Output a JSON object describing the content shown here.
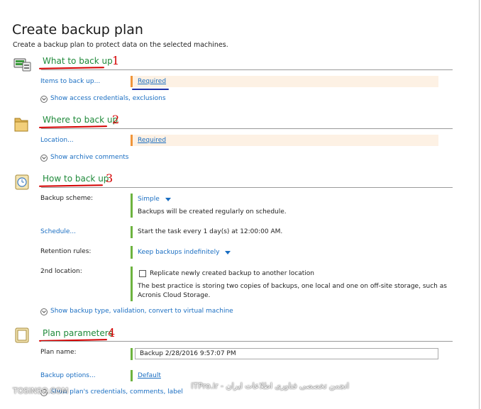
{
  "page": {
    "title": "Create backup plan",
    "subtitle": "Create a backup plan to protect data on the selected machines."
  },
  "sections": {
    "what": {
      "title": "What to back up",
      "number": "1",
      "items_label": "Items to back up...",
      "items_value": "Required",
      "expand_link": "Show access credentials, exclusions"
    },
    "where": {
      "title": "Where to back up",
      "number": "2",
      "location_label": "Location...",
      "location_value": "Required",
      "expand_link": "Show archive comments"
    },
    "how": {
      "title": "How to back up",
      "number": "3",
      "scheme_label": "Backup scheme:",
      "scheme_value": "Simple",
      "scheme_desc": "Backups will be created regularly on schedule.",
      "schedule_label": "Schedule...",
      "schedule_value": "Start the task every 1 day(s) at 12:00:00 AM.",
      "retention_label": "Retention rules:",
      "retention_value": "Keep backups indefinitely",
      "second_label": "2nd location:",
      "second_checkbox": "Replicate newly created backup to another location",
      "second_desc_1": "The best practice is storing two copies of backups, one local and one on off-site storage, such as",
      "second_desc_2": "Acronis Cloud Storage.",
      "expand_link": "Show backup type, validation, convert to virtual machine"
    },
    "plan": {
      "title": "Plan parameters",
      "number": "4",
      "name_label": "Plan name:",
      "name_value": "Backup 2/28/2016 9:57:07 PM",
      "options_label": "Backup options...",
      "options_value": "Default",
      "expand_link": "Show plan's credentials, comments, label"
    }
  },
  "watermark": {
    "left": "TOSINSO.COM",
    "right": "انجمن تخصصی فناوری اطلاعات ایران - ITPro.ir"
  },
  "colors": {
    "accent_green": "#1f8a3a",
    "link_blue": "#1a6ec2",
    "required_orange": "#f0953a",
    "ok_green": "#6db33f",
    "annotation_red": "#d40000"
  }
}
